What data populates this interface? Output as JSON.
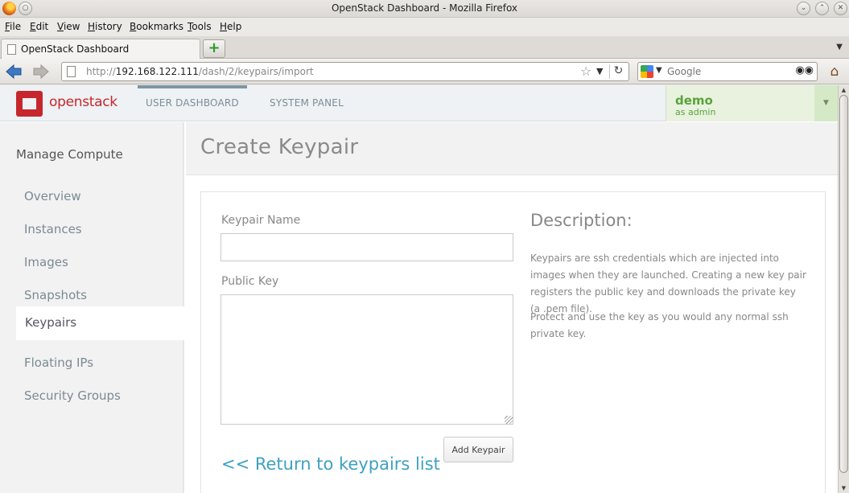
{
  "window": {
    "title": "OpenStack Dashboard - Mozilla Firefox",
    "controls": [
      "⌄",
      "⌃",
      "✕"
    ]
  },
  "menu": [
    "File",
    "Edit",
    "View",
    "History",
    "Bookmarks",
    "Tools",
    "Help"
  ],
  "tab": {
    "label": "OpenStack Dashboard",
    "new_tab": "+"
  },
  "nav": {
    "url_prefix": "http://",
    "url_host": "192.168.122.111",
    "url_path": "/dash/2/keypairs/import",
    "search_placeholder": "Google"
  },
  "header": {
    "logo_text": "openstack",
    "nav_items": [
      "USER DASHBOARD",
      "SYSTEM PANEL"
    ],
    "active_nav": "USER DASHBOARD",
    "user": {
      "name": "demo",
      "role": "as admin"
    }
  },
  "sidebar": {
    "title": "Manage Compute",
    "items": [
      "Overview",
      "Instances",
      "Images",
      "Snapshots",
      "Keypairs",
      "Floating IPs",
      "Security Groups"
    ],
    "active": "Keypairs"
  },
  "page": {
    "title": "Create Keypair",
    "form": {
      "name_label": "Keypair Name",
      "name_value": "",
      "key_label": "Public Key",
      "key_value": "",
      "submit_label": "Add Keypair",
      "return_link": "<< Return to keypairs list"
    },
    "description": {
      "title": "Description:",
      "paragraphs": [
        "Keypairs are ssh credentials which are injected into images when they are launched. Creating a new key pair registers the public key and downloads the private key (a .pem file).",
        "Protect and use the key as you would any normal ssh private key."
      ]
    }
  },
  "colors": {
    "brand_red": "#c6272d",
    "link_blue": "#3ea1c1",
    "user_green": "#5aa33b"
  }
}
